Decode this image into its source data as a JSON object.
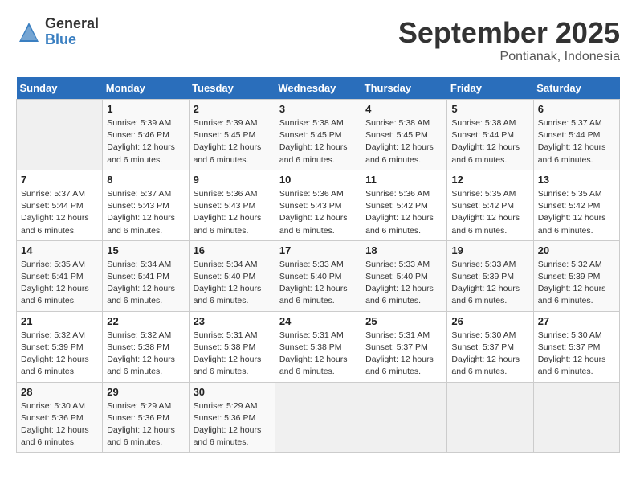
{
  "header": {
    "logo_general": "General",
    "logo_blue": "Blue",
    "month_title": "September 2025",
    "location": "Pontianak, Indonesia"
  },
  "days_of_week": [
    "Sunday",
    "Monday",
    "Tuesday",
    "Wednesday",
    "Thursday",
    "Friday",
    "Saturday"
  ],
  "weeks": [
    [
      {
        "day": "",
        "empty": true
      },
      {
        "day": "1",
        "sunrise": "Sunrise: 5:39 AM",
        "sunset": "Sunset: 5:46 PM",
        "daylight": "Daylight: 12 hours and 6 minutes."
      },
      {
        "day": "2",
        "sunrise": "Sunrise: 5:39 AM",
        "sunset": "Sunset: 5:45 PM",
        "daylight": "Daylight: 12 hours and 6 minutes."
      },
      {
        "day": "3",
        "sunrise": "Sunrise: 5:38 AM",
        "sunset": "Sunset: 5:45 PM",
        "daylight": "Daylight: 12 hours and 6 minutes."
      },
      {
        "day": "4",
        "sunrise": "Sunrise: 5:38 AM",
        "sunset": "Sunset: 5:45 PM",
        "daylight": "Daylight: 12 hours and 6 minutes."
      },
      {
        "day": "5",
        "sunrise": "Sunrise: 5:38 AM",
        "sunset": "Sunset: 5:44 PM",
        "daylight": "Daylight: 12 hours and 6 minutes."
      },
      {
        "day": "6",
        "sunrise": "Sunrise: 5:37 AM",
        "sunset": "Sunset: 5:44 PM",
        "daylight": "Daylight: 12 hours and 6 minutes."
      }
    ],
    [
      {
        "day": "7",
        "sunrise": "Sunrise: 5:37 AM",
        "sunset": "Sunset: 5:44 PM",
        "daylight": "Daylight: 12 hours and 6 minutes."
      },
      {
        "day": "8",
        "sunrise": "Sunrise: 5:37 AM",
        "sunset": "Sunset: 5:43 PM",
        "daylight": "Daylight: 12 hours and 6 minutes."
      },
      {
        "day": "9",
        "sunrise": "Sunrise: 5:36 AM",
        "sunset": "Sunset: 5:43 PM",
        "daylight": "Daylight: 12 hours and 6 minutes."
      },
      {
        "day": "10",
        "sunrise": "Sunrise: 5:36 AM",
        "sunset": "Sunset: 5:43 PM",
        "daylight": "Daylight: 12 hours and 6 minutes."
      },
      {
        "day": "11",
        "sunrise": "Sunrise: 5:36 AM",
        "sunset": "Sunset: 5:42 PM",
        "daylight": "Daylight: 12 hours and 6 minutes."
      },
      {
        "day": "12",
        "sunrise": "Sunrise: 5:35 AM",
        "sunset": "Sunset: 5:42 PM",
        "daylight": "Daylight: 12 hours and 6 minutes."
      },
      {
        "day": "13",
        "sunrise": "Sunrise: 5:35 AM",
        "sunset": "Sunset: 5:42 PM",
        "daylight": "Daylight: 12 hours and 6 minutes."
      }
    ],
    [
      {
        "day": "14",
        "sunrise": "Sunrise: 5:35 AM",
        "sunset": "Sunset: 5:41 PM",
        "daylight": "Daylight: 12 hours and 6 minutes."
      },
      {
        "day": "15",
        "sunrise": "Sunrise: 5:34 AM",
        "sunset": "Sunset: 5:41 PM",
        "daylight": "Daylight: 12 hours and 6 minutes."
      },
      {
        "day": "16",
        "sunrise": "Sunrise: 5:34 AM",
        "sunset": "Sunset: 5:40 PM",
        "daylight": "Daylight: 12 hours and 6 minutes."
      },
      {
        "day": "17",
        "sunrise": "Sunrise: 5:33 AM",
        "sunset": "Sunset: 5:40 PM",
        "daylight": "Daylight: 12 hours and 6 minutes."
      },
      {
        "day": "18",
        "sunrise": "Sunrise: 5:33 AM",
        "sunset": "Sunset: 5:40 PM",
        "daylight": "Daylight: 12 hours and 6 minutes."
      },
      {
        "day": "19",
        "sunrise": "Sunrise: 5:33 AM",
        "sunset": "Sunset: 5:39 PM",
        "daylight": "Daylight: 12 hours and 6 minutes."
      },
      {
        "day": "20",
        "sunrise": "Sunrise: 5:32 AM",
        "sunset": "Sunset: 5:39 PM",
        "daylight": "Daylight: 12 hours and 6 minutes."
      }
    ],
    [
      {
        "day": "21",
        "sunrise": "Sunrise: 5:32 AM",
        "sunset": "Sunset: 5:39 PM",
        "daylight": "Daylight: 12 hours and 6 minutes."
      },
      {
        "day": "22",
        "sunrise": "Sunrise: 5:32 AM",
        "sunset": "Sunset: 5:38 PM",
        "daylight": "Daylight: 12 hours and 6 minutes."
      },
      {
        "day": "23",
        "sunrise": "Sunrise: 5:31 AM",
        "sunset": "Sunset: 5:38 PM",
        "daylight": "Daylight: 12 hours and 6 minutes."
      },
      {
        "day": "24",
        "sunrise": "Sunrise: 5:31 AM",
        "sunset": "Sunset: 5:38 PM",
        "daylight": "Daylight: 12 hours and 6 minutes."
      },
      {
        "day": "25",
        "sunrise": "Sunrise: 5:31 AM",
        "sunset": "Sunset: 5:37 PM",
        "daylight": "Daylight: 12 hours and 6 minutes."
      },
      {
        "day": "26",
        "sunrise": "Sunrise: 5:30 AM",
        "sunset": "Sunset: 5:37 PM",
        "daylight": "Daylight: 12 hours and 6 minutes."
      },
      {
        "day": "27",
        "sunrise": "Sunrise: 5:30 AM",
        "sunset": "Sunset: 5:37 PM",
        "daylight": "Daylight: 12 hours and 6 minutes."
      }
    ],
    [
      {
        "day": "28",
        "sunrise": "Sunrise: 5:30 AM",
        "sunset": "Sunset: 5:36 PM",
        "daylight": "Daylight: 12 hours and 6 minutes."
      },
      {
        "day": "29",
        "sunrise": "Sunrise: 5:29 AM",
        "sunset": "Sunset: 5:36 PM",
        "daylight": "Daylight: 12 hours and 6 minutes."
      },
      {
        "day": "30",
        "sunrise": "Sunrise: 5:29 AM",
        "sunset": "Sunset: 5:36 PM",
        "daylight": "Daylight: 12 hours and 6 minutes."
      },
      {
        "day": "",
        "empty": true
      },
      {
        "day": "",
        "empty": true
      },
      {
        "day": "",
        "empty": true
      },
      {
        "day": "",
        "empty": true
      }
    ]
  ]
}
